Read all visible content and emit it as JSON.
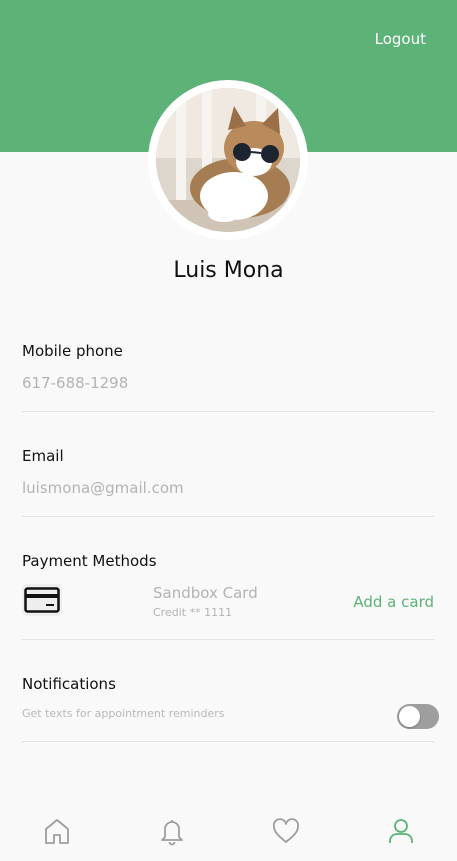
{
  "header": {
    "logout_label": "Logout",
    "background_color": "#5cb277"
  },
  "profile": {
    "name": "Luis Mona",
    "avatar": "cat-with-sunglasses-photo"
  },
  "fields": {
    "phone": {
      "label": "Mobile phone",
      "value": "617-688-1298"
    },
    "email": {
      "label": "Email",
      "value": "luismona@gmail.com"
    }
  },
  "payment": {
    "label": "Payment Methods",
    "card_icon": "credit-card-icon",
    "card_name": "Sandbox Card",
    "card_detail": "Credit ** 1111",
    "add_label": "Add a card"
  },
  "notifications": {
    "label": "Notifications",
    "description": "Get texts for appointment reminders",
    "enabled": false
  },
  "tabbar": {
    "items": [
      {
        "icon": "home-icon",
        "active": false
      },
      {
        "icon": "bell-icon",
        "active": false
      },
      {
        "icon": "heart-icon",
        "active": false
      },
      {
        "icon": "user-icon",
        "active": true
      }
    ],
    "active_color": "#5cb277",
    "inactive_color": "#9e9e9e"
  }
}
